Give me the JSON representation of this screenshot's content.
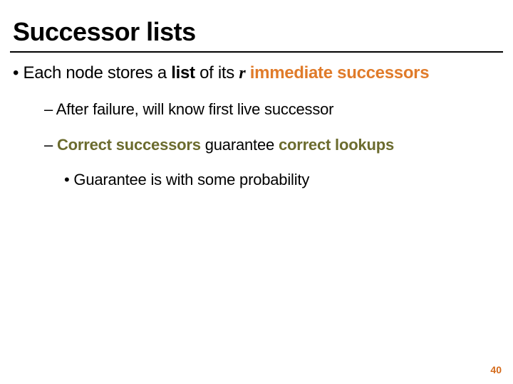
{
  "title": "Successor lists",
  "p1": {
    "pre": "Each node stores a ",
    "list": "list",
    "mid": " of its ",
    "r": "r",
    "post": " immediate successors"
  },
  "s1": "After failure, will know first live successor",
  "s2": {
    "a": "Correct successors",
    "b": " guarantee ",
    "c": "correct lookups"
  },
  "s3": "Guarantee is with some probability",
  "page_number": "40"
}
